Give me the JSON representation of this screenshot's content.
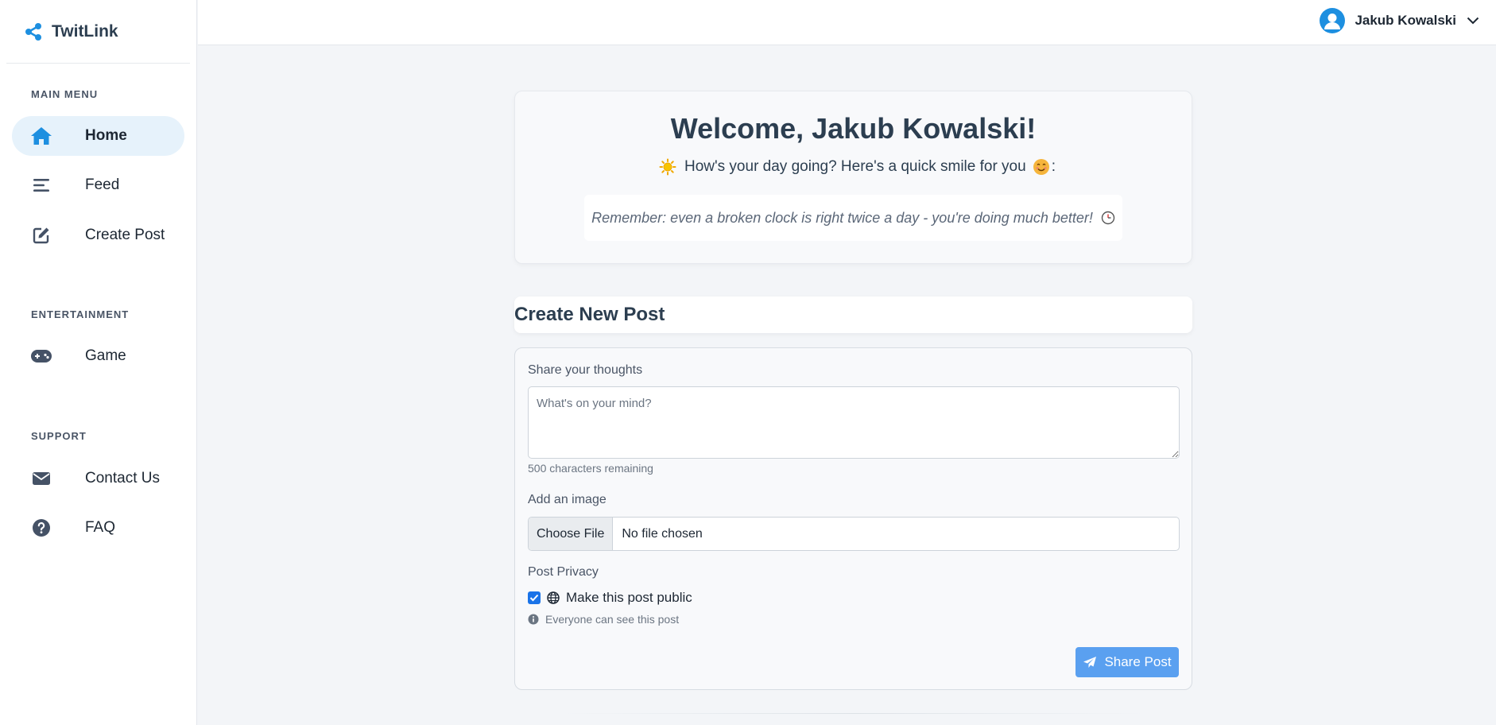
{
  "app": {
    "name": "TwitLink"
  },
  "sidebar": {
    "sections": [
      {
        "title": "MAIN MENU",
        "items": [
          {
            "label": "Home",
            "icon": "home-icon",
            "active": true
          },
          {
            "label": "Feed",
            "icon": "bars-icon",
            "active": false
          },
          {
            "label": "Create Post",
            "icon": "edit-icon",
            "active": false
          }
        ]
      },
      {
        "title": "ENTERTAINMENT",
        "items": [
          {
            "label": "Game",
            "icon": "gamepad-icon",
            "active": false
          }
        ]
      },
      {
        "title": "SUPPORT",
        "items": [
          {
            "label": "Contact Us",
            "icon": "envelope-icon",
            "active": false
          },
          {
            "label": "FAQ",
            "icon": "question-circle-icon",
            "active": false
          }
        ]
      }
    ]
  },
  "header": {
    "user_name": "Jakub Kowalski"
  },
  "welcome": {
    "title": "Welcome, Jakub Kowalski!",
    "subtitle": "How's your day going? Here's a quick smile for you",
    "subtitle_suffix": ":",
    "quote": "Remember: even a broken clock is right twice a day - you're doing much better!"
  },
  "create_post": {
    "heading": "Create New Post",
    "thoughts_label": "Share your thoughts",
    "thoughts_placeholder": "What's on your mind?",
    "counter": "500 characters remaining",
    "image_label": "Add an image",
    "file_button": "Choose File",
    "file_status": "No file chosen",
    "privacy_label": "Post Privacy",
    "public_label": "Make this post public",
    "public_checked": true,
    "hint": "Everyone can see this post",
    "share_button": "Share Post"
  },
  "colors": {
    "accent": "#1d8fe0",
    "active_bg": "#e6f2fb",
    "share_button": "#5aa0f0",
    "checkbox": "#1a73e8"
  }
}
